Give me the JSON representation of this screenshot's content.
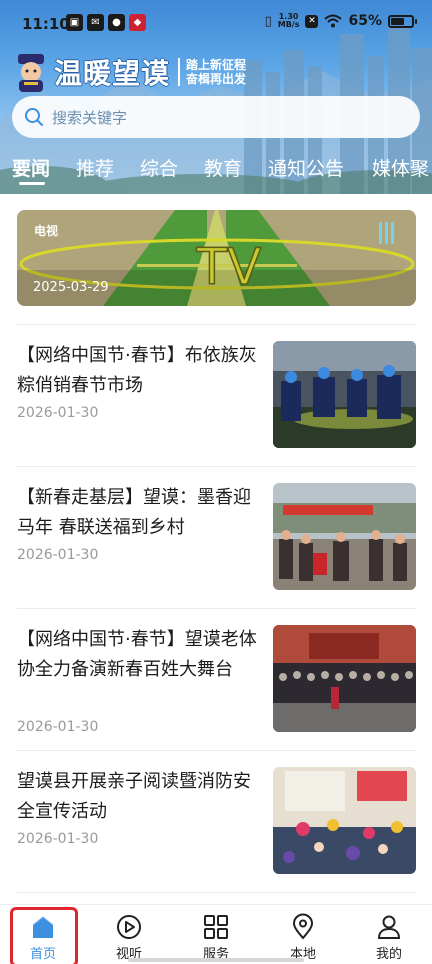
{
  "status_bar": {
    "time": "11:10",
    "net_speed_value": "1.30",
    "net_speed_unit": "MB/s",
    "battery": "65%",
    "battery_level": 0.65
  },
  "header": {
    "app_name": "温暖望谟",
    "slogan_line1": "踏上新征程",
    "slogan_line2": "奋楫再出发"
  },
  "search": {
    "placeholder": "搜索关键字"
  },
  "tabs": [
    {
      "label": "要闻",
      "active": true
    },
    {
      "label": "推荐"
    },
    {
      "label": "综合"
    },
    {
      "label": "教育"
    },
    {
      "label": "通知公告"
    },
    {
      "label": "媒体聚"
    }
  ],
  "banner": {
    "tag": "电视",
    "date": "2025-03-29",
    "logo_text": "TV"
  },
  "articles": [
    {
      "title": "【网络中国节·春节】布依族灰粽俏销春节市场",
      "date": "2026-01-30"
    },
    {
      "title": "【新春走基层】望谟：墨香迎马年 春联送福到乡村",
      "date": "2026-01-30"
    },
    {
      "title": "【网络中国节·春节】望谟老体协全力备演新春百姓大舞台",
      "date": "2026-01-30"
    },
    {
      "title": "望谟县开展亲子阅读暨消防安全宣传活动",
      "date": "2026-01-30"
    }
  ],
  "bottom_nav": [
    {
      "label": "首页",
      "icon": "home-icon",
      "active": true
    },
    {
      "label": "视听",
      "icon": "play-circle-icon"
    },
    {
      "label": "服务",
      "icon": "grid-icon"
    },
    {
      "label": "本地",
      "icon": "location-pin-icon"
    },
    {
      "label": "我的",
      "icon": "user-icon"
    }
  ],
  "colors": {
    "accent": "#3d8fe0",
    "highlight_box": "#e0262f",
    "header_sky": "#5aa4e6"
  }
}
